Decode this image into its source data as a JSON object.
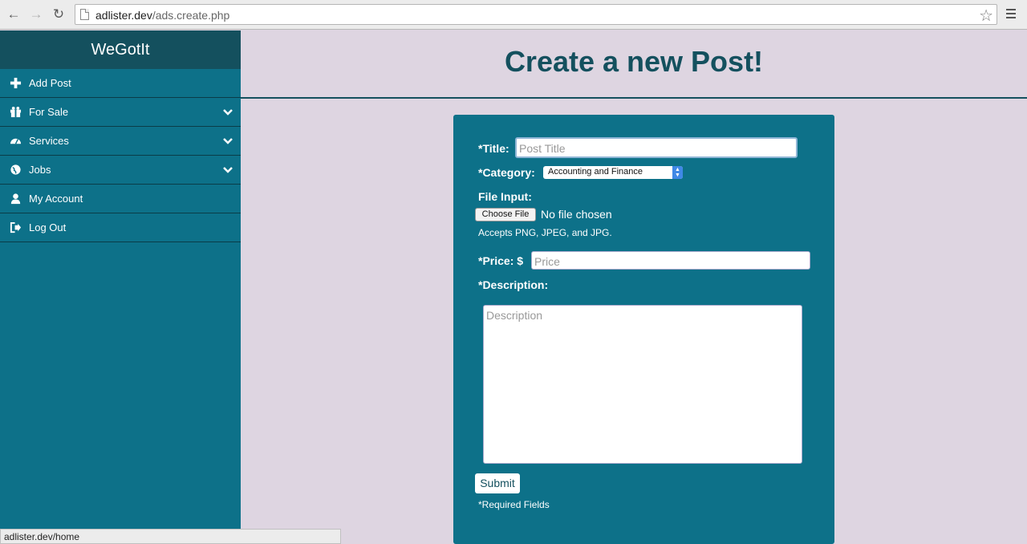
{
  "browser": {
    "url_host": "adlister.dev",
    "url_path": "/ads.create.php",
    "status_url": "adlister.dev/home"
  },
  "sidebar": {
    "brand": "WeGotIt",
    "items": [
      {
        "label": "Add Post",
        "icon": "plus-icon"
      },
      {
        "label": "For Sale",
        "icon": "gift-icon",
        "expandable": true
      },
      {
        "label": "Services",
        "icon": "dashboard-icon",
        "expandable": true
      },
      {
        "label": "Jobs",
        "icon": "globe-icon",
        "expandable": true
      },
      {
        "label": "My Account",
        "icon": "user-icon"
      },
      {
        "label": "Log Out",
        "icon": "logout-icon"
      }
    ]
  },
  "main": {
    "title": "Create a new Post!"
  },
  "form": {
    "title_label": "*Title:",
    "title_placeholder": "Post Title",
    "category_label": "*Category:",
    "category_value": "Accounting and Finance",
    "file_label": "File Input:",
    "choose_file": "Choose File",
    "file_status": "No file chosen",
    "accepts": "Accepts PNG, JPEG, and JPG.",
    "price_label": "*Price: $",
    "price_placeholder": "Price",
    "description_label": "*Description:",
    "description_placeholder": "Description",
    "submit": "Submit",
    "required_note": "*Required Fields"
  },
  "colors": {
    "sidebar": "#0d7189",
    "brand_bar": "#14505e",
    "page_bg": "#ded5e1",
    "title_text": "#14505e"
  }
}
